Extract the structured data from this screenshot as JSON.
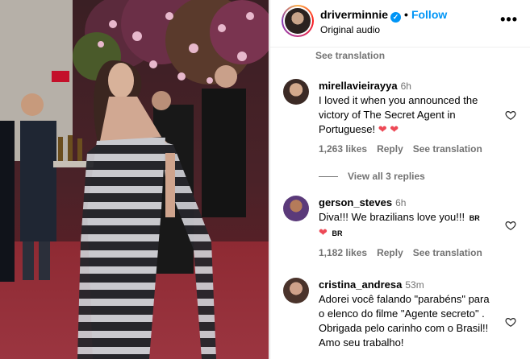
{
  "post": {
    "username": "driverminnie",
    "follow_label": "Follow",
    "audio_label": "Original audio",
    "more_icon": "•••"
  },
  "top_partial": {
    "see_translation": "See translation"
  },
  "comments": [
    {
      "username": "mirellavieirayya",
      "time": "6h",
      "text": "I loved it when you announced the victory of The Secret Agent in Portuguese! ❤️ ❤️",
      "likes": "1,263 likes",
      "reply": "Reply",
      "see_translation": "See translation",
      "view_replies": "View all 3 replies"
    },
    {
      "username": "gerson_steves",
      "time": "6h",
      "text_line1": "Diva!!! We brazilians love you!!!",
      "flag1": "BR",
      "text_line2_heart": "❤",
      "flag2": "BR",
      "likes": "1,182 likes",
      "reply": "Reply",
      "see_translation": "See translation"
    },
    {
      "username": "cristina_andresa",
      "time": "53m",
      "text": "Adorei você falando \"parabéns\" para o elenco do filme \"Agente secreto\" . Obrigada pelo carinho com o Brasil!! Amo seu trabalho!"
    }
  ],
  "colors": {
    "link_blue": "#0095f6",
    "muted": "#737373",
    "heart": "#ed4956"
  }
}
